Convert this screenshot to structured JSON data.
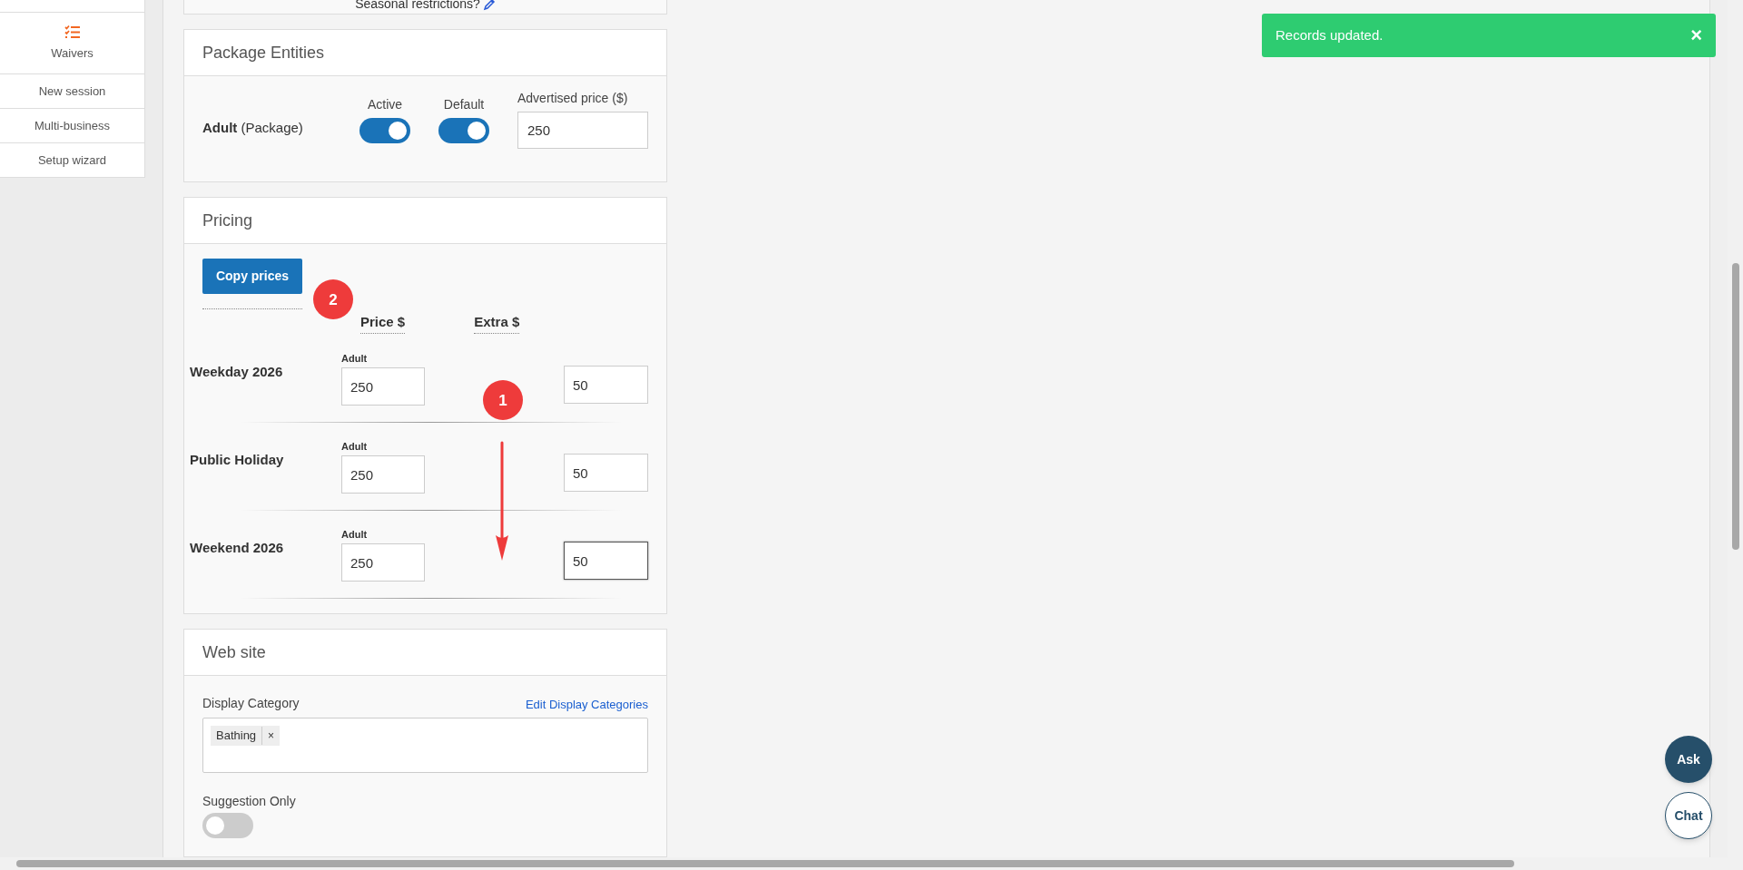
{
  "sidebar": {
    "items": [
      {
        "label": "Waivers",
        "kind": "icon"
      },
      {
        "label": "New session",
        "kind": "text"
      },
      {
        "label": "Multi-business",
        "kind": "text"
      },
      {
        "label": "Setup wizard",
        "kind": "text"
      }
    ]
  },
  "seasonal": {
    "text": "Seasonal restrictions?"
  },
  "package_entities": {
    "title": "Package Entities",
    "active_label": "Active",
    "default_label": "Default",
    "price_label": "Advertised price ($)",
    "entities": [
      {
        "name": "Adult",
        "type": "(Package)",
        "active": true,
        "default": true,
        "price": "250"
      }
    ]
  },
  "pricing": {
    "title": "Pricing",
    "copy_button": "Copy prices",
    "headers": [
      "Price $",
      "Extra $"
    ],
    "rows": [
      {
        "name": "Weekday 2026",
        "sub_label": "Adult",
        "price": "250",
        "extra": "50",
        "focused": false
      },
      {
        "name": "Public Holiday",
        "sub_label": "Adult",
        "price": "250",
        "extra": "50",
        "focused": false
      },
      {
        "name": "Weekend 2026",
        "sub_label": "Adult",
        "price": "250",
        "extra": "50",
        "focused": true
      }
    ]
  },
  "website": {
    "title": "Web site",
    "display_category_label": "Display Category",
    "edit_link": "Edit Display Categories",
    "tags": [
      {
        "label": "Bathing",
        "remove": "×"
      }
    ],
    "suggestion_label": "Suggestion Only",
    "suggestion_only": false
  },
  "toast": {
    "message": "Records updated.",
    "close": "×"
  },
  "floating_buttons": [
    {
      "label": "Ask",
      "kind": "filled"
    },
    {
      "label": "Chat",
      "kind": "outline"
    }
  ],
  "annotations": [
    {
      "label": "2"
    },
    {
      "label": "1"
    }
  ]
}
